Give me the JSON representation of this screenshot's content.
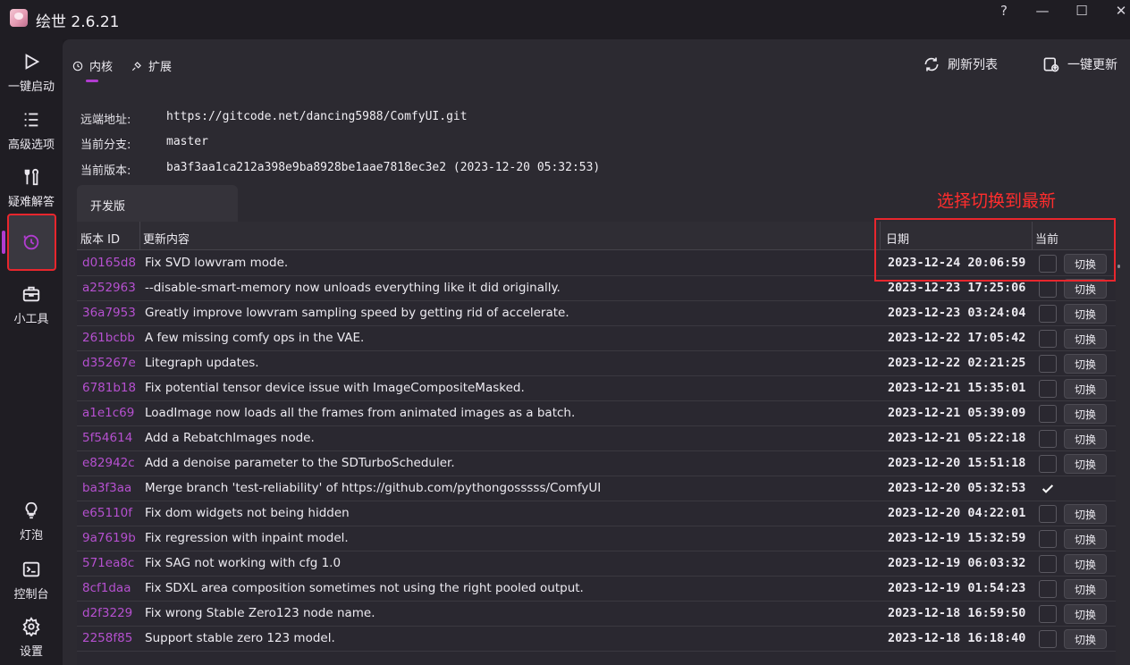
{
  "app": {
    "title": "绘世 2.6.21"
  },
  "window_controls": {
    "help": "?",
    "minimize": "—",
    "maximize": "☐",
    "close": "✕"
  },
  "sidebar": {
    "items": [
      {
        "label": "一键启动",
        "icon": "play-icon"
      },
      {
        "label": "高级选项",
        "icon": "list-icon"
      },
      {
        "label": "疑难解答",
        "icon": "tools-icon"
      },
      {
        "label": "",
        "icon": "history-icon",
        "active": true
      },
      {
        "label": "小工具",
        "icon": "toolbox-icon"
      },
      {
        "label": "灯泡",
        "icon": "bulb-icon"
      },
      {
        "label": "控制台",
        "icon": "console-icon"
      },
      {
        "label": "设置",
        "icon": "gear-icon"
      }
    ]
  },
  "tabs": [
    {
      "label": "内核",
      "icon": "history-icon",
      "active": true
    },
    {
      "label": "扩展",
      "icon": "plugin-icon",
      "active": false
    }
  ],
  "actions": {
    "refresh": "刷新列表",
    "update_all": "一键更新"
  },
  "info": {
    "remote_label": "远端地址:",
    "remote_value": "https://gitcode.net/dancing5988/ComfyUI.git",
    "branch_label": "当前分支:",
    "branch_value": "master",
    "version_label": "当前版本:",
    "version_value": "ba3f3aa1ca212a398e9ba8928be1aae7818ec3e2 (2023-12-20 05:32:53)"
  },
  "branch_tab": "开发版",
  "annotation": "选择切换到最新",
  "table": {
    "headers": {
      "id": "版本 ID",
      "content": "更新内容",
      "date": "日期",
      "current": "当前"
    },
    "switch_label": "切换",
    "rows": [
      {
        "id": "d0165d8",
        "msg": "Fix SVD lowvram mode.",
        "date": "2023-12-24 20:06:59",
        "current": false
      },
      {
        "id": "a252963",
        "msg": "--disable-smart-memory now unloads everything like it did originally.",
        "date": "2023-12-23 17:25:06",
        "current": false
      },
      {
        "id": "36a7953",
        "msg": "Greatly improve lowvram sampling speed by getting rid of accelerate.",
        "date": "2023-12-23 03:24:04",
        "current": false
      },
      {
        "id": "261bcbb",
        "msg": "A few missing comfy ops in the VAE.",
        "date": "2023-12-22 17:05:42",
        "current": false
      },
      {
        "id": "d35267e",
        "msg": "Litegraph updates.",
        "date": "2023-12-22 02:21:25",
        "current": false
      },
      {
        "id": "6781b18",
        "msg": "Fix potential tensor device issue with ImageCompositeMasked.",
        "date": "2023-12-21 15:35:01",
        "current": false
      },
      {
        "id": "a1e1c69",
        "msg": "LoadImage now loads all the frames from animated images as a batch.",
        "date": "2023-12-21 05:39:09",
        "current": false
      },
      {
        "id": "5f54614",
        "msg": "Add a RebatchImages node.",
        "date": "2023-12-21 05:22:18",
        "current": false
      },
      {
        "id": "e82942c",
        "msg": "Add a denoise parameter to the SDTurboScheduler.",
        "date": "2023-12-20 15:51:18",
        "current": false
      },
      {
        "id": "ba3f3aa",
        "msg": "Merge branch 'test-reliability' of https://github.com/pythongosssss/ComfyUI",
        "date": "2023-12-20 05:32:53",
        "current": true
      },
      {
        "id": "e65110f",
        "msg": "Fix dom widgets not being hidden",
        "date": "2023-12-20 04:22:01",
        "current": false
      },
      {
        "id": "9a7619b",
        "msg": "Fix regression with inpaint model.",
        "date": "2023-12-19 15:32:59",
        "current": false
      },
      {
        "id": "571ea8c",
        "msg": "Fix SAG not working with cfg 1.0",
        "date": "2023-12-19 06:03:32",
        "current": false
      },
      {
        "id": "8cf1daa",
        "msg": "Fix SDXL area composition sometimes not using the right pooled output.",
        "date": "2023-12-19 01:54:23",
        "current": false
      },
      {
        "id": "d2f3229",
        "msg": "Fix wrong Stable Zero123 node name.",
        "date": "2023-12-18 16:59:50",
        "current": false
      },
      {
        "id": "2258f85",
        "msg": "Support stable zero 123 model.",
        "date": "2023-12-18 16:18:40",
        "current": false
      }
    ]
  }
}
